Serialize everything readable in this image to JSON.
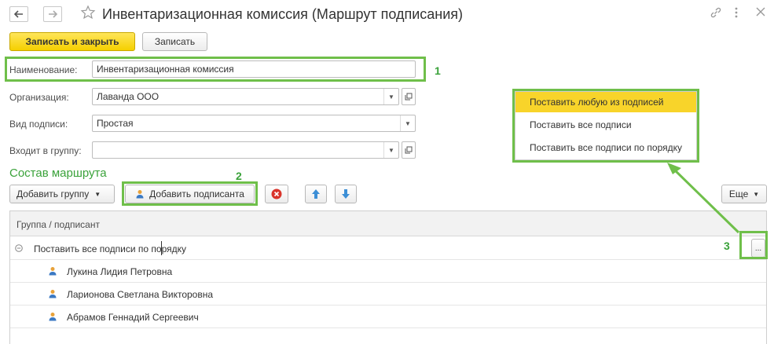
{
  "window": {
    "title": "Инвентаризационная комиссия (Маршрут подписания)"
  },
  "toolbar": {
    "save_close_label": "Записать и закрыть",
    "save_label": "Записать"
  },
  "form": {
    "name_label": "Наименование:",
    "name_value": "Инвентаризационная комиссия",
    "org_label": "Организация:",
    "org_value": "Лаванда ООО",
    "sign_type_label": "Вид подписи:",
    "sign_type_value": "Простая",
    "group_label": "Входит в группу:",
    "group_value": ""
  },
  "route": {
    "section_title": "Состав маршрута",
    "add_group_label": "Добавить группу",
    "add_signer_label": "Добавить подписанта",
    "more_label": "Еще",
    "column_header": "Группа / подписант",
    "rows": [
      {
        "text": "Поставить все подписи по порядку",
        "type": "group"
      },
      {
        "text": "Лукина Лидия Петровна",
        "type": "person"
      },
      {
        "text": "Ларионова Светлана Викторовна",
        "type": "person"
      },
      {
        "text": "Абрамов Геннадий Сергеевич",
        "type": "person"
      }
    ],
    "ellipsis_label": "..."
  },
  "menu": {
    "items": [
      {
        "label": "Поставить любую из подписей",
        "selected": true
      },
      {
        "label": "Поставить все подписи",
        "selected": false
      },
      {
        "label": "Поставить все подписи по порядку",
        "selected": false
      }
    ]
  },
  "annotations": {
    "n1": "1",
    "n2": "2",
    "n3": "3"
  },
  "colors": {
    "accent_green": "#6fbf4a",
    "primary_yellow": "#f5d000",
    "selected_item": "#f8d42a",
    "delete_red": "#d9342b",
    "arrow_blue": "#3d8fd6"
  }
}
